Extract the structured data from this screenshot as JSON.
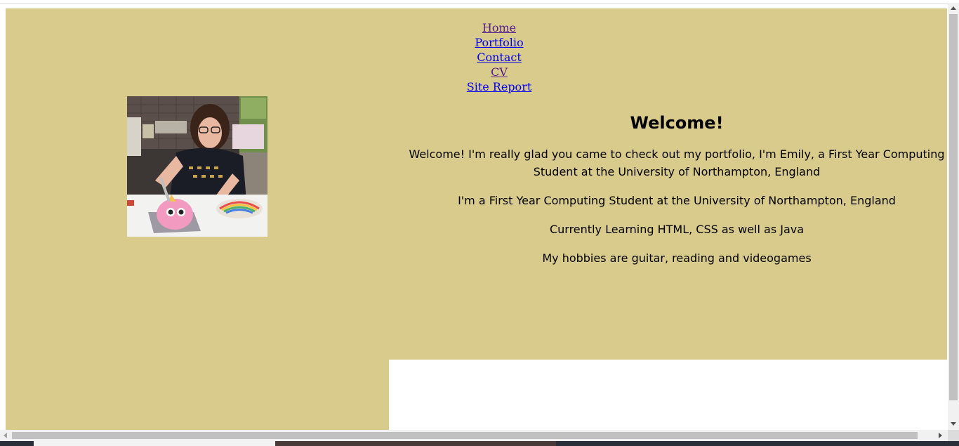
{
  "nav": {
    "links": [
      {
        "label": "Home"
      },
      {
        "label": "Portfolio"
      },
      {
        "label": "Contact"
      },
      {
        "label": "CV"
      },
      {
        "label": "Site Report"
      }
    ]
  },
  "photo": {
    "alt": "Emily cutting a pink unicorn cake"
  },
  "main": {
    "heading": "Welcome!",
    "paragraphs": [
      "Welcome! I'm really glad you came to check out my portfolio, I'm Emily, a First Year Computing Student at the University of Northampton, England",
      "I'm a First Year Computing Student at the University of Northampton, England",
      "Currently Learning HTML, CSS as well as Java",
      "My hobbies are guitar, reading and videogames"
    ]
  },
  "colors": {
    "panel_background": "#d9cb8b",
    "visited_link": "#551a8b",
    "unvisited_link": "#0000ee"
  }
}
